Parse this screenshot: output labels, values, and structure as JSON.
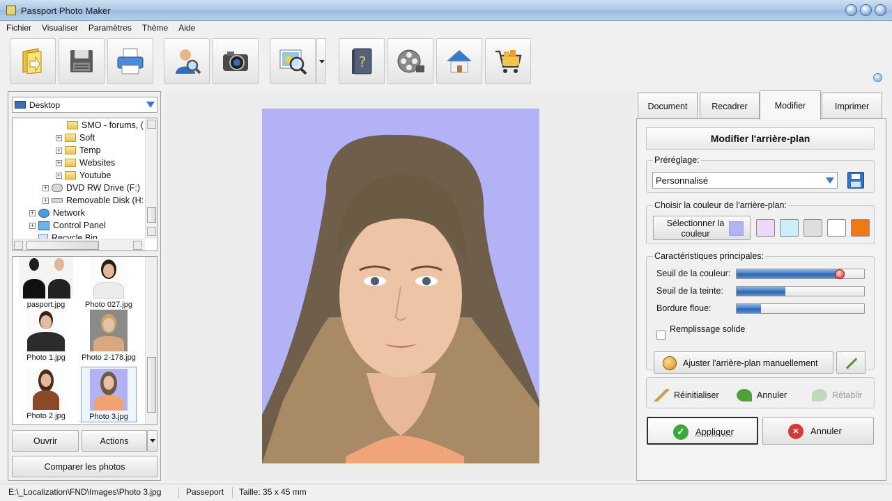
{
  "window": {
    "title": "Passport Photo Maker"
  },
  "menu": [
    "Fichier",
    "Visualiser",
    "Paramètres",
    "Thème",
    "Aide"
  ],
  "toolbar": {
    "buttons": [
      "open-icon",
      "save-icon",
      "print-icon",
      "person-search-icon",
      "camera-icon",
      "image-zoom-icon",
      "help-book-icon",
      "film-reel-icon",
      "home-icon",
      "shopping-cart-icon"
    ]
  },
  "browser": {
    "location": "Desktop",
    "tree": [
      {
        "label": "SMO - forums, (",
        "type": "folder"
      },
      {
        "label": "Soft",
        "type": "folder"
      },
      {
        "label": "Temp",
        "type": "folder"
      },
      {
        "label": "Websites",
        "type": "folder"
      },
      {
        "label": "Youtube",
        "type": "folder"
      },
      {
        "label": "DVD RW Drive (F:)",
        "type": "dvd"
      },
      {
        "label": "Removable Disk (H:",
        "type": "removable"
      },
      {
        "label": "Network",
        "type": "network"
      },
      {
        "label": "Control Panel",
        "type": "control"
      },
      {
        "label": "Recycle Bin",
        "type": "recycle"
      }
    ],
    "thumbnails": [
      {
        "caption": "pasport.jpg"
      },
      {
        "caption": "Photo 027.jpg"
      },
      {
        "caption": "Photo 1.jpg"
      },
      {
        "caption": "Photo 2-178.jpg"
      },
      {
        "caption": "Photo 2.jpg"
      },
      {
        "caption": "Photo 3.jpg",
        "selected": true
      }
    ],
    "open_label": "Ouvrir",
    "actions_label": "Actions",
    "compare_label": "Comparer les photos"
  },
  "tabs": [
    "Document",
    "Recadrer",
    "Modifier",
    "Imprimer"
  ],
  "active_tab": "Modifier",
  "edit": {
    "title": "Modifier l'arrière-plan",
    "preset_label": "Préréglage:",
    "preset_value": "Personnalisé",
    "color_group_label": "Choisir la couleur de l'arrière-plan:",
    "select_color_label": "Sélectionner la couleur",
    "current_color": "#b3b2f6",
    "swatches": [
      "#ecd9f7",
      "#cbeefb",
      "#dedede",
      "#ffffff",
      "#f07a12"
    ],
    "params_label": "Caractéristiques principales:",
    "sliders": [
      {
        "label": "Seuil de la couleur:",
        "value": 0.79
      },
      {
        "label": "Seuil de la teinte:",
        "value": 0.38
      },
      {
        "label": "Bordure floue:",
        "value": 0.19
      }
    ],
    "solid_fill_label": "Remplissage solide",
    "solid_fill_checked": false,
    "manual_label": "Ajuster l'arrière-plan manuellement",
    "reset_label": "Réinitialiser",
    "undo_label": "Annuler",
    "redo_label": "Rétablir",
    "apply_label": "Appliquer",
    "cancel_label": "Annuler"
  },
  "status": {
    "path": "E:\\_Localization\\FND\\Images\\Photo 3.jpg",
    "format": "Passeport",
    "size": "Taille: 35 x 45 mm"
  }
}
